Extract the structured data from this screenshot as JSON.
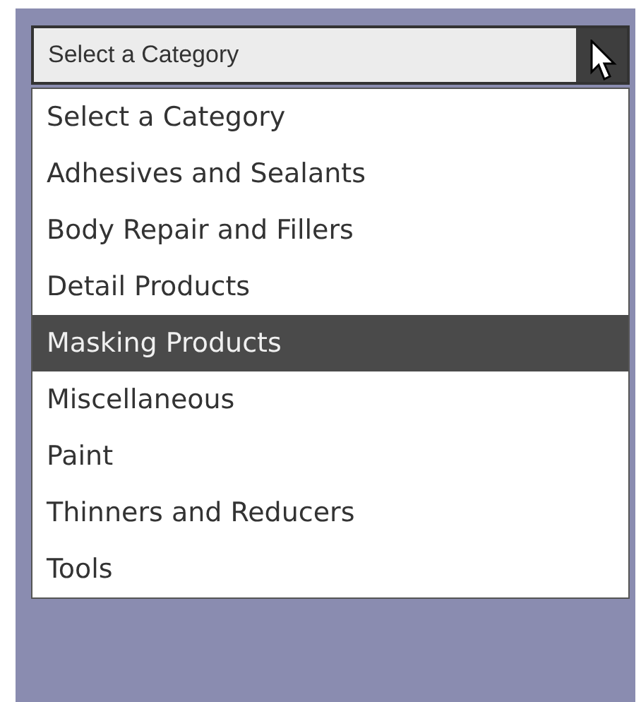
{
  "select": {
    "value": "Select a Category"
  },
  "options": [
    {
      "label": "Select a Category",
      "selected": false
    },
    {
      "label": "Adhesives and Sealants",
      "selected": false
    },
    {
      "label": "Body Repair and Fillers",
      "selected": false
    },
    {
      "label": "Detail Products",
      "selected": false
    },
    {
      "label": "Masking Products",
      "selected": true
    },
    {
      "label": "Miscellaneous",
      "selected": false
    },
    {
      "label": "Paint",
      "selected": false
    },
    {
      "label": "Thinners and Reducers",
      "selected": false
    },
    {
      "label": "Tools",
      "selected": false
    }
  ]
}
